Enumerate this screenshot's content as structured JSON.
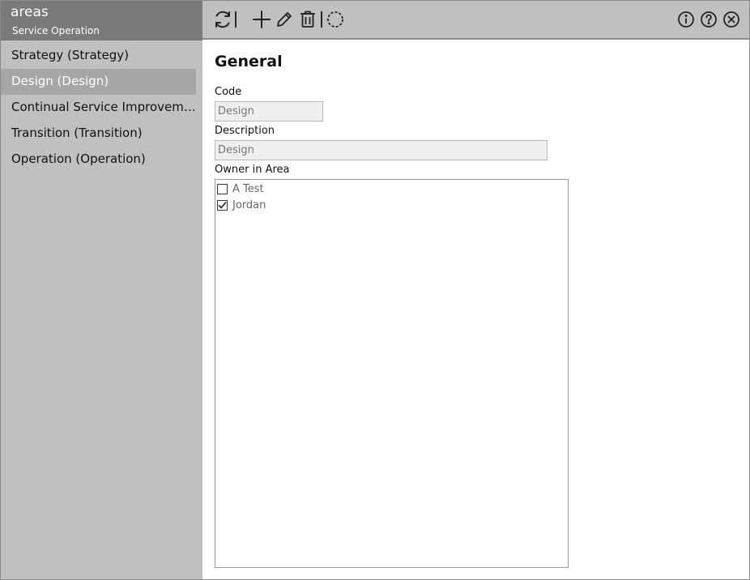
{
  "sidebar": {
    "title": "areas",
    "subtitle": "Service Operation",
    "items": [
      {
        "label": "Strategy (Strategy)",
        "active": false
      },
      {
        "label": "Design (Design)",
        "active": true
      },
      {
        "label": "Continual Service Improveme...",
        "active": false
      },
      {
        "label": "Transition (Transition)",
        "active": false
      },
      {
        "label": "Operation (Operation)",
        "active": false
      }
    ]
  },
  "toolbar": {
    "icons": [
      "refresh-icon",
      "add-icon",
      "edit-icon",
      "delete-icon",
      "loading-circle-icon",
      "info-icon",
      "help-icon",
      "close-icon"
    ]
  },
  "form": {
    "section_title": "General",
    "code_label": "Code",
    "code_value": "Design",
    "description_label": "Description",
    "description_value": "Design",
    "owner_label": "Owner in Area",
    "owners": [
      {
        "name": "A Test",
        "checked": false
      },
      {
        "name": "Jordan",
        "checked": true
      }
    ]
  }
}
